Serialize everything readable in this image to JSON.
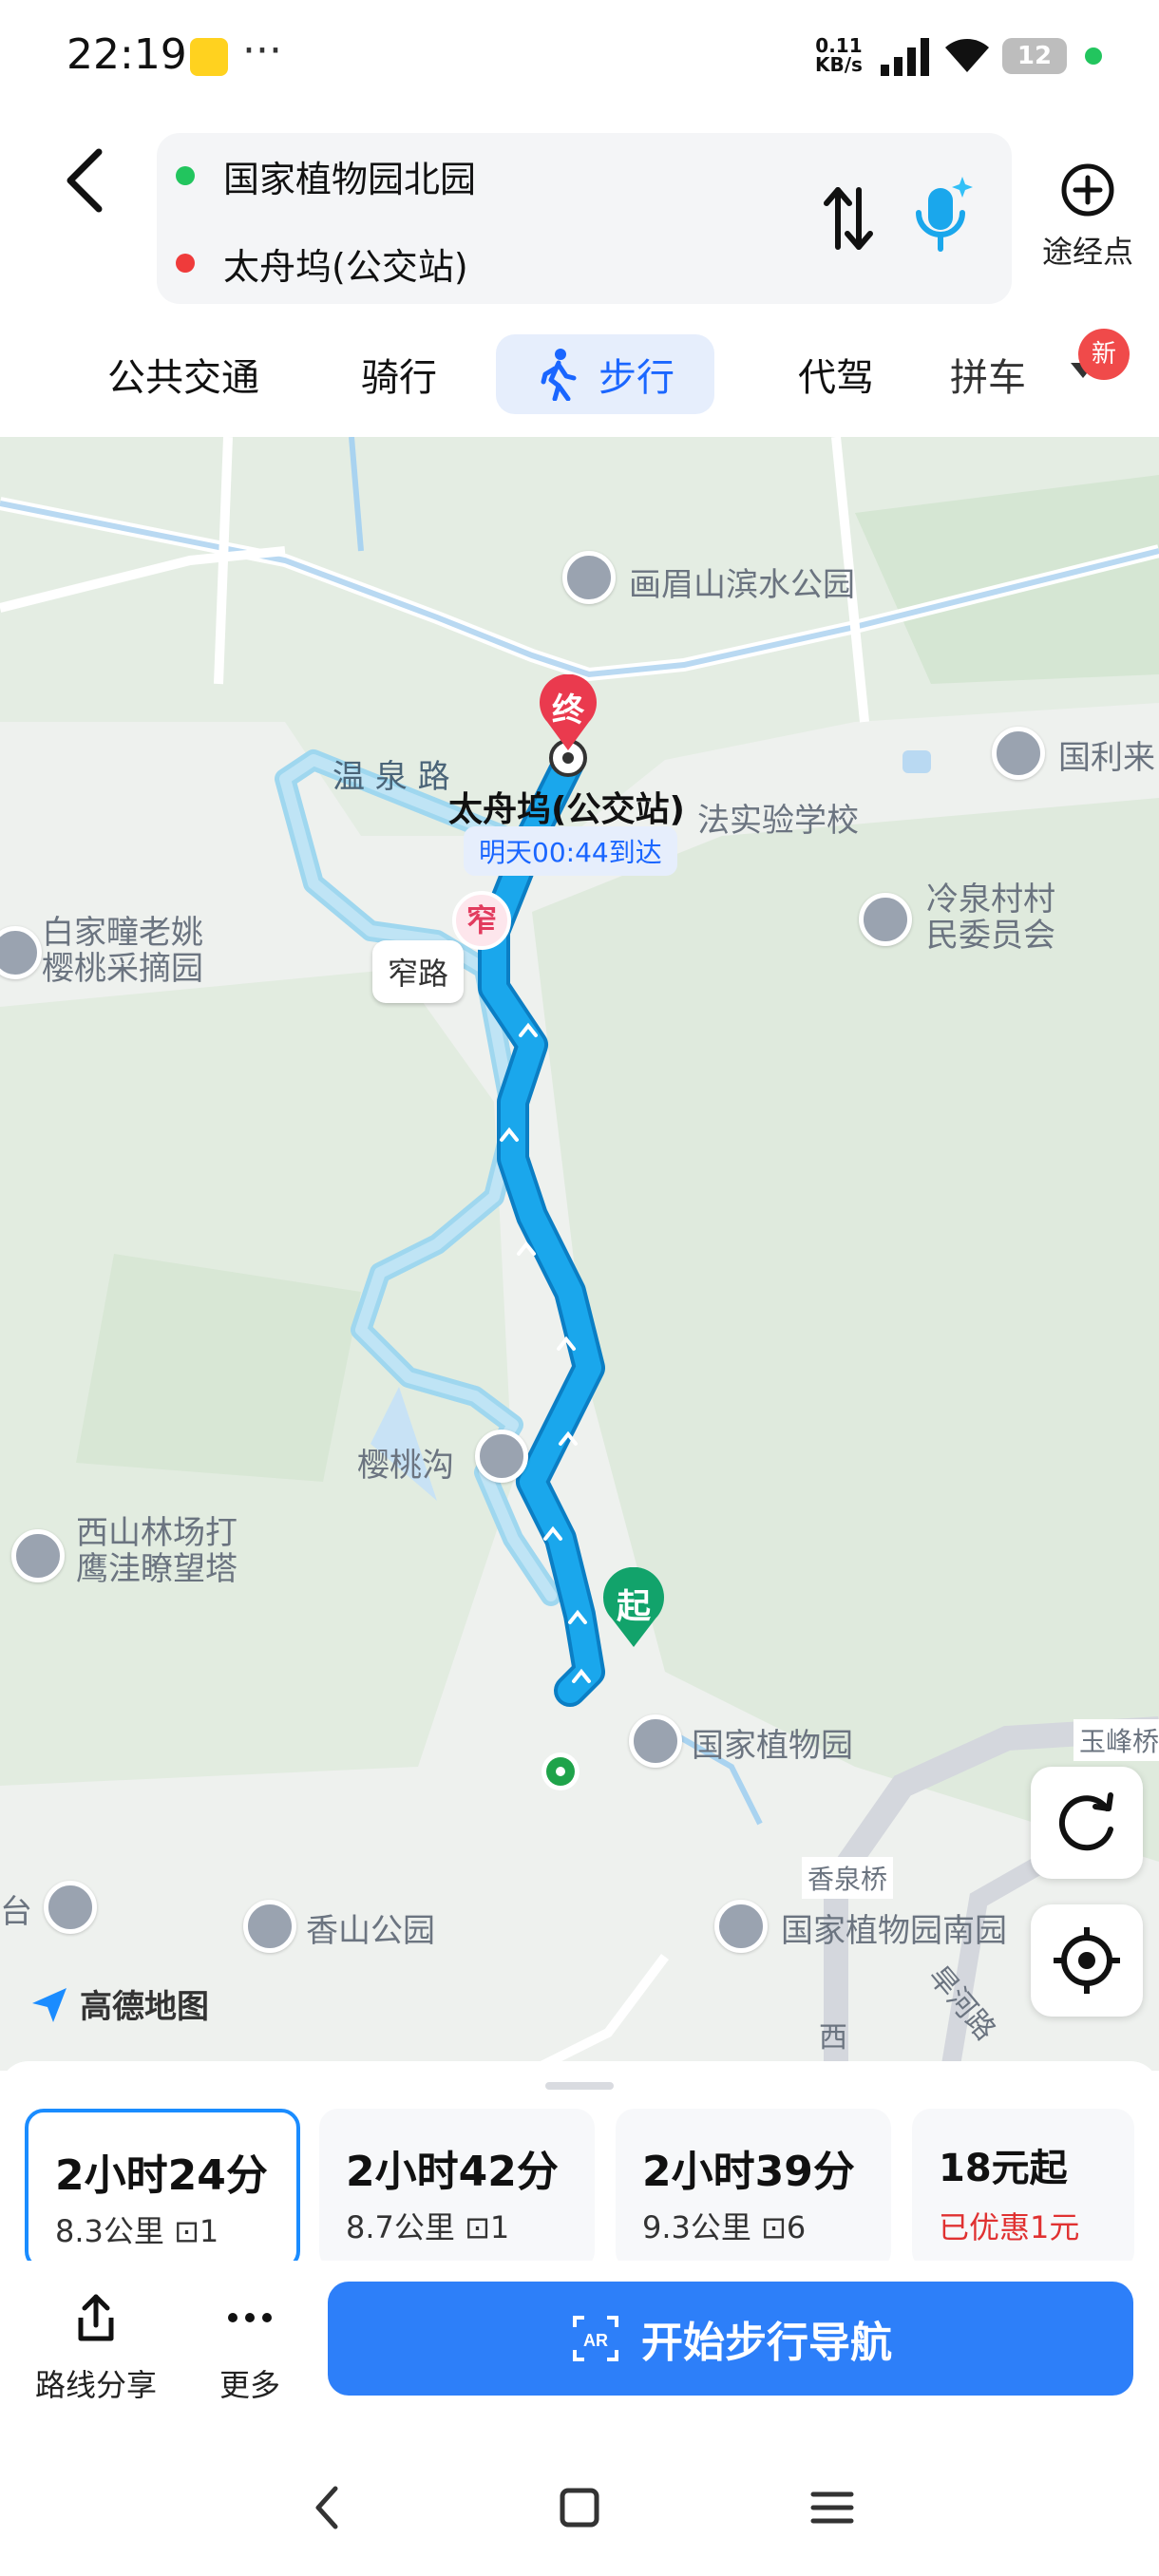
{
  "status_bar": {
    "time": "22:19",
    "dots": "···",
    "net_speed_top": "0.11",
    "net_speed_bottom": "KB/s",
    "battery": "12"
  },
  "route": {
    "from": "国家植物园北园",
    "to": "太舟坞(公交站)",
    "waypoint_label": "途经点",
    "from_color": "#22c55e",
    "to_color": "#ef3b3b"
  },
  "tabs": [
    {
      "label": "公共交通"
    },
    {
      "label": "骑行"
    },
    {
      "label": "步行"
    },
    {
      "label": "代驾"
    },
    {
      "label": "拼车"
    }
  ],
  "new_badge": "新",
  "map": {
    "labels": {
      "huameishan": "画眉山滨水公园",
      "wenquan_road": "温 泉 路",
      "destination": "太舟坞(公交站)",
      "school": "法实验学校",
      "guoli": "国利来",
      "lengquan": "冷泉村村\n民委员会",
      "baijia": "白家疃老姚\n樱桃采摘园",
      "narrow_road": "窄路",
      "yingtaogou": "樱桃沟",
      "xishan": "西山林场打\n鹰洼瞭望塔",
      "zhiwuyuan": "国家植物园",
      "yufeng": "玉峰桥",
      "xiangquan_bridge": "香泉桥",
      "xiangshan": "香山公园",
      "south_garden": "国家植物园南园",
      "tai": "台",
      "hanhe_road": "旱河路",
      "xi": "西"
    },
    "eta": "明天00:44到达",
    "end_marker": "终",
    "start_marker": "起",
    "narrow_marker": "窄",
    "logo": "高德地图",
    "route_color": "#1aa7ec",
    "alt_route_color": "#8dd3ef"
  },
  "options": [
    {
      "time": "2小时24分",
      "detail": "8.3公里 ⊡1"
    },
    {
      "time": "2小时42分",
      "detail": "8.7公里 ⊡1"
    },
    {
      "time": "2小时39分",
      "detail": "9.3公里 ⊡6"
    },
    {
      "time": "18元起",
      "detail": "已优惠1元"
    }
  ],
  "actions": {
    "share": "路线分享",
    "more": "更多",
    "start_nav": "开始步行导航"
  }
}
